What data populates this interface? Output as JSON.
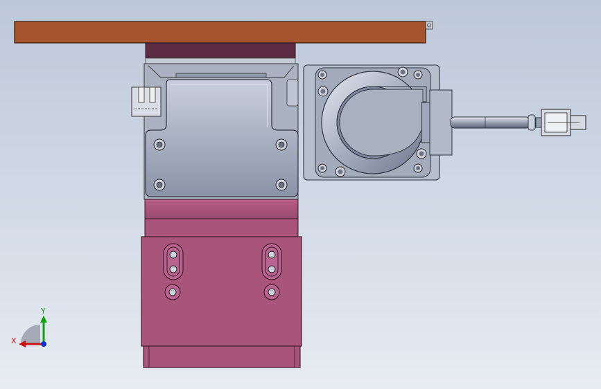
{
  "viewport": {
    "background_top": "#bcc7d8",
    "background_bottom": "#e8ecf2"
  },
  "model": {
    "top_plate_color": "#a5532c",
    "carriage_color": "#a9547a",
    "carriage_dark_color": "#5c2c42",
    "metal_color": "#8d96aa",
    "metal_light_color": "#c8ceda"
  },
  "triad": {
    "x_label": "X",
    "y_label": "Y",
    "x_color": "#d01010",
    "y_color": "#10a010",
    "z_color": "#1030d0"
  }
}
